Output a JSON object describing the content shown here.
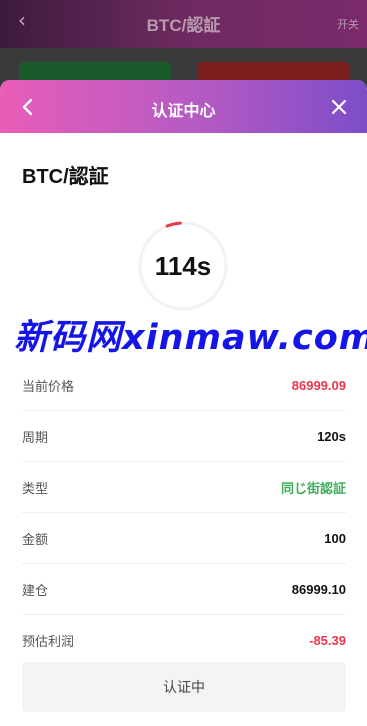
{
  "background": {
    "back_icon": "chevron-left-icon",
    "title": "BTC/認証",
    "right_label": "开关"
  },
  "modal": {
    "title": "认证中心",
    "back_icon": "chevron-left-icon",
    "close_icon": "close-icon",
    "pair": "BTC/認証",
    "countdown": "114s",
    "countdown_progress": 0.05,
    "watermark": "新码网xinmaw.com",
    "rows": [
      {
        "label": "当前价格",
        "value": "86999.09"
      },
      {
        "label": "周期",
        "value": "120s"
      },
      {
        "label": "类型",
        "value": "同じ街認証"
      },
      {
        "label": "金额",
        "value": "100"
      },
      {
        "label": "建仓",
        "value": "86999.10"
      },
      {
        "label": "预估利润",
        "value": "-85.39"
      }
    ],
    "status_button": "认证中"
  },
  "colors": {
    "header_gradient_start": "#e85db8",
    "header_gradient_end": "#7c4dc8",
    "price_red": "#e8364a",
    "type_green": "#3fae5a",
    "watermark_blue": "#1515e8",
    "progress_arc": "#e8364a"
  }
}
